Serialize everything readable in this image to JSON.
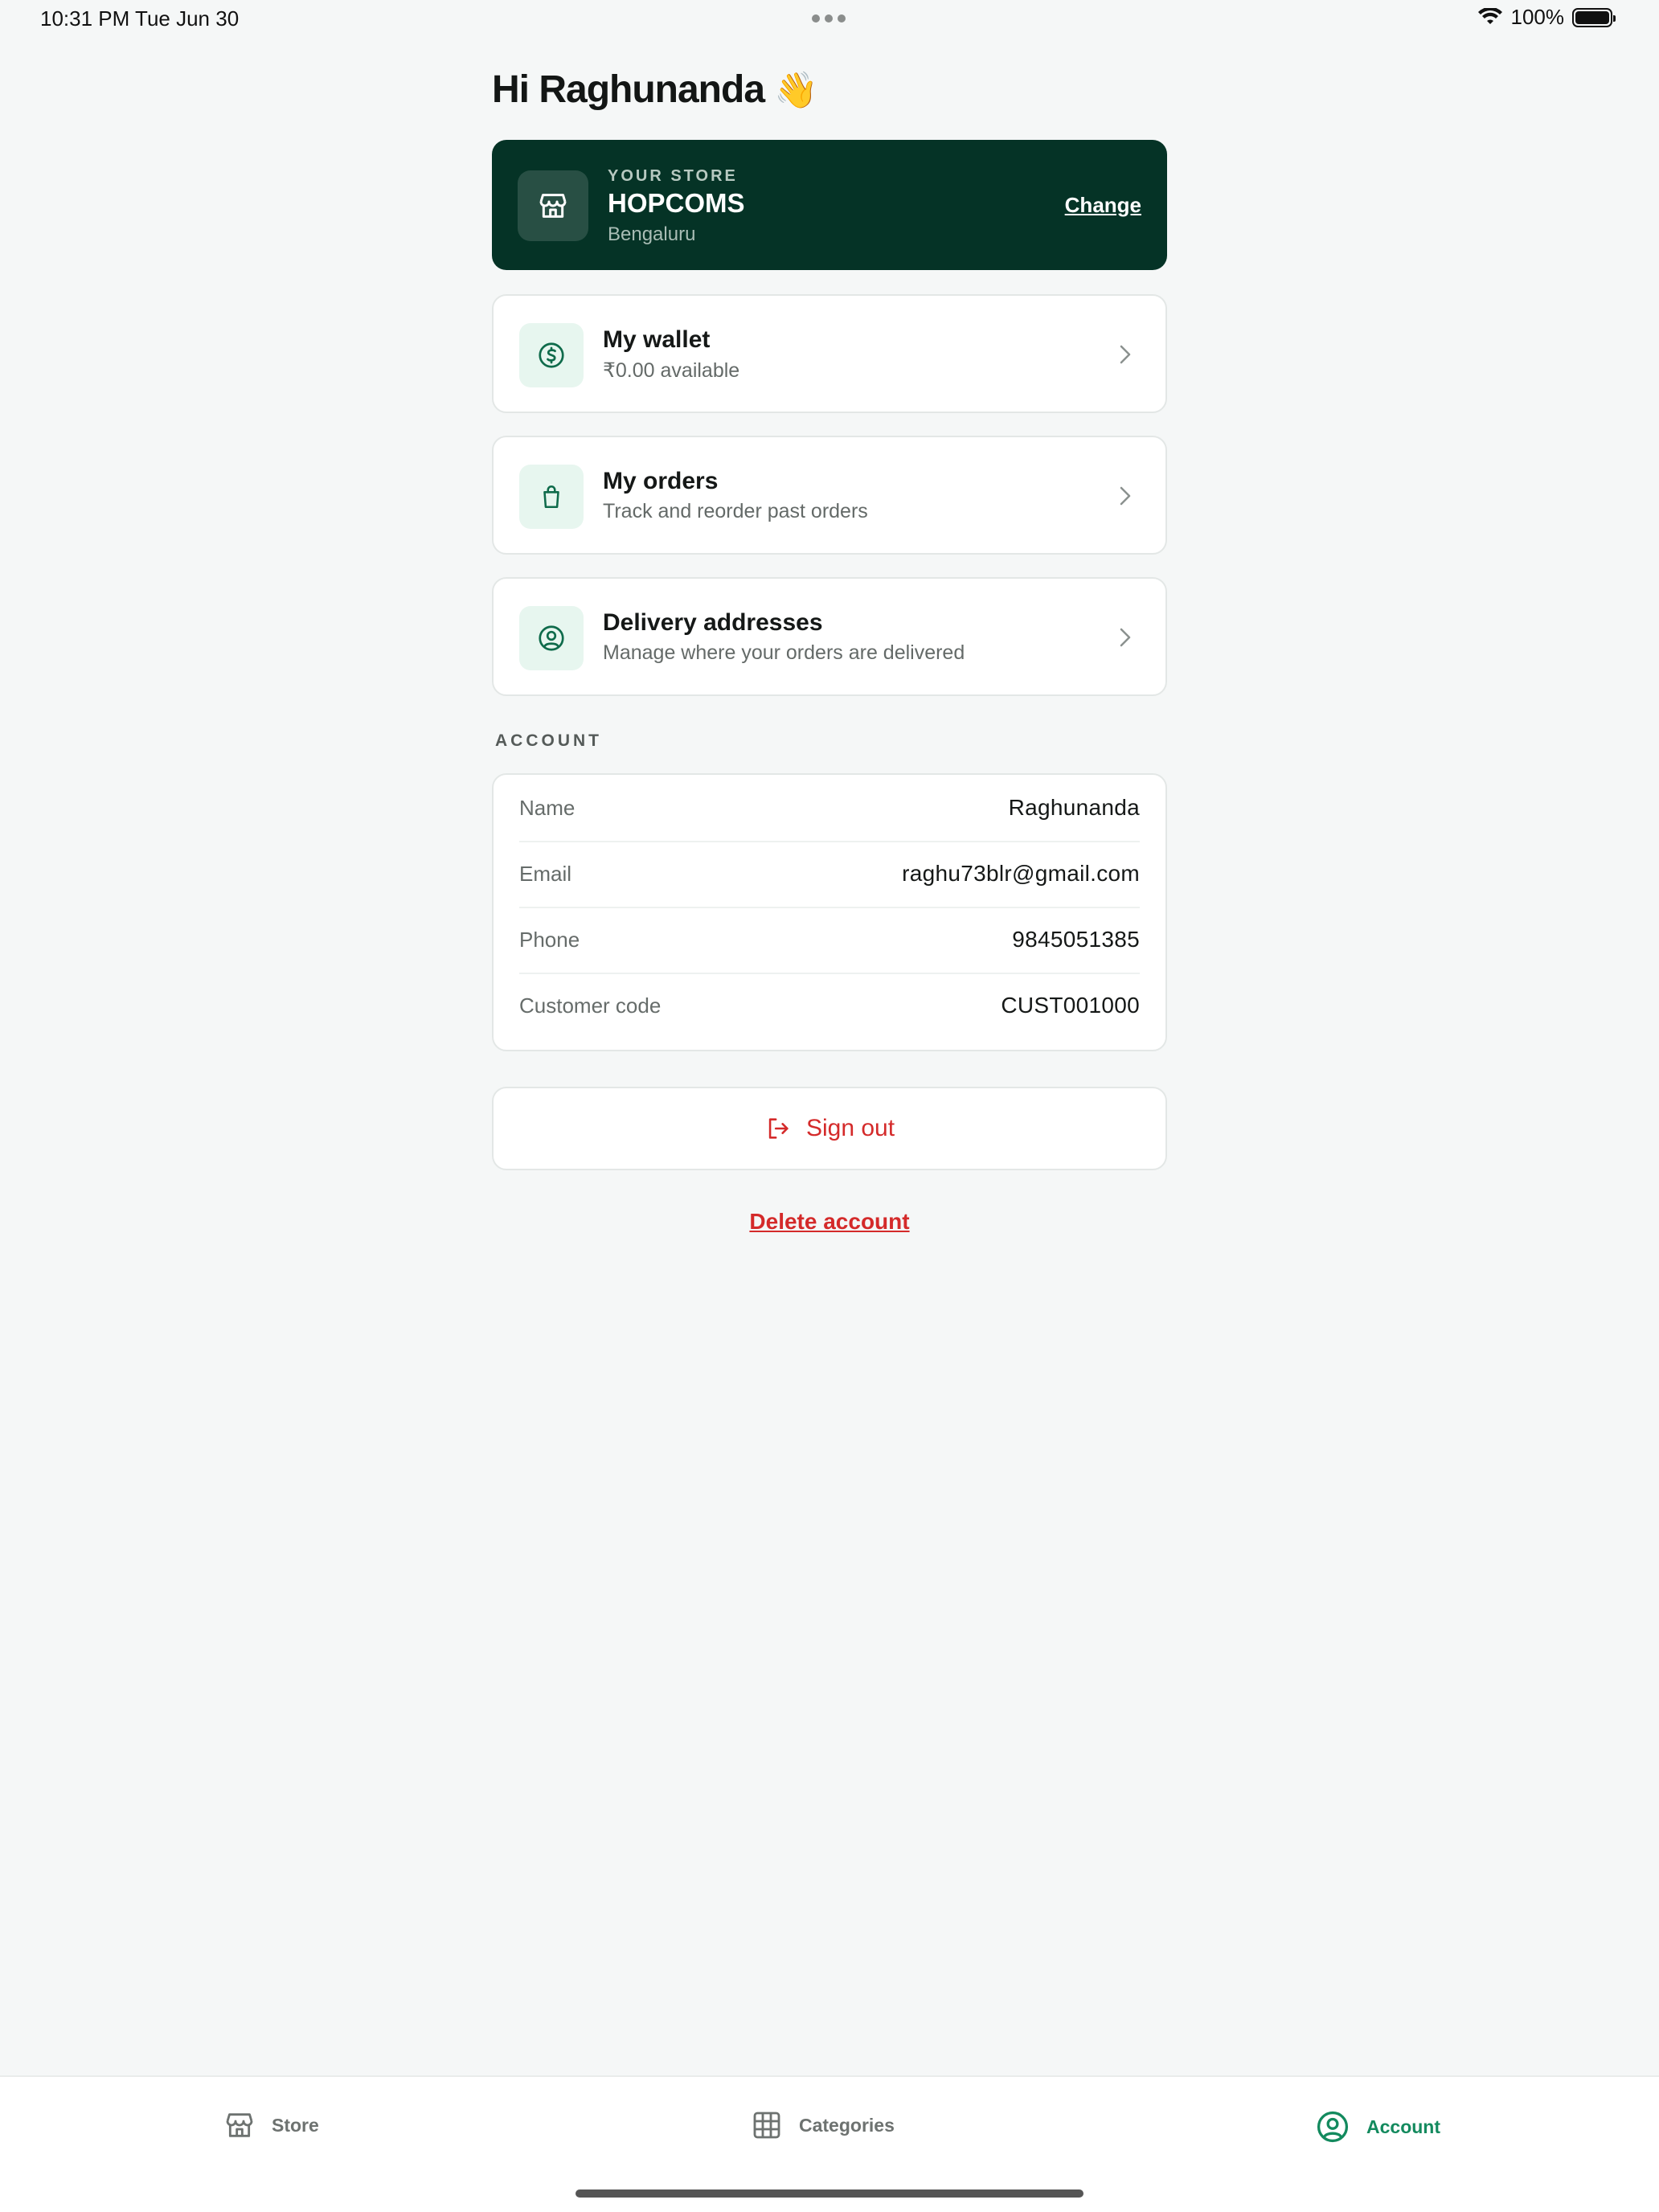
{
  "status_bar": {
    "time": "10:31 PM   Tue Jun 30",
    "battery": "100%"
  },
  "greeting": {
    "text": "Hi Raghunanda",
    "emoji": "👋"
  },
  "store": {
    "kicker": "YOUR STORE",
    "name": "HOPCOMS",
    "city": "Bengaluru",
    "change_label": "Change"
  },
  "menu": [
    {
      "title": "My wallet",
      "subtitle": "₹0.00 available",
      "icon": "wallet-coin-icon"
    },
    {
      "title": "My orders",
      "subtitle": "Track and reorder past orders",
      "icon": "shopping-bag-icon"
    },
    {
      "title": "Delivery addresses",
      "subtitle": "Manage where your orders are delivered",
      "icon": "user-circle-icon"
    }
  ],
  "account": {
    "section_label": "ACCOUNT",
    "rows": [
      {
        "label": "Name",
        "value": "Raghunanda"
      },
      {
        "label": "Email",
        "value": "raghu73blr@gmail.com"
      },
      {
        "label": "Phone",
        "value": "9845051385"
      },
      {
        "label": "Customer code",
        "value": "CUST001000"
      }
    ]
  },
  "sign_out_label": "Sign out",
  "delete_account_label": "Delete account",
  "tabs": [
    {
      "label": "Store",
      "icon": "storefront-icon",
      "active": false
    },
    {
      "label": "Categories",
      "icon": "grid-icon",
      "active": false
    },
    {
      "label": "Account",
      "icon": "account-circle-icon",
      "active": true
    }
  ],
  "colors": {
    "background": "#f5f7f7",
    "store_card": "#053326",
    "accent_green": "#138a5e",
    "icon_tint_bg": "#e7f6ef",
    "danger_red": "#d42a2a"
  }
}
